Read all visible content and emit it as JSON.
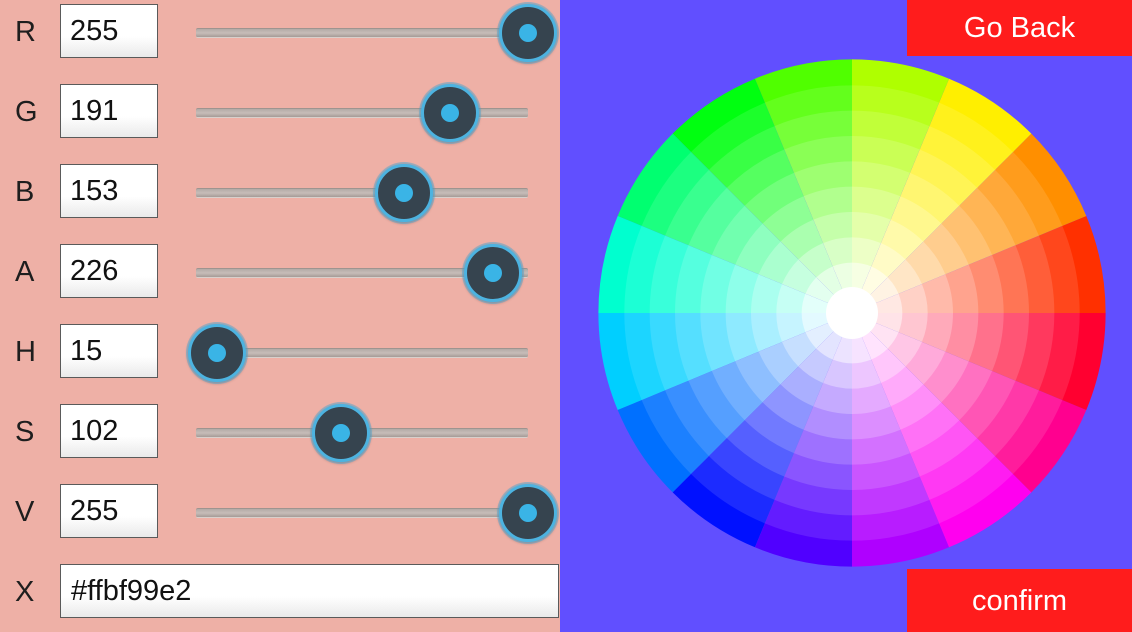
{
  "channels": [
    {
      "label": "R",
      "value": "255",
      "fraction": 1.0
    },
    {
      "label": "G",
      "value": "191",
      "fraction": 0.749
    },
    {
      "label": "B",
      "value": "153",
      "fraction": 0.6
    },
    {
      "label": "A",
      "value": "226",
      "fraction": 0.886
    },
    {
      "label": "H",
      "value": "15",
      "fraction": 0.0
    },
    {
      "label": "S",
      "value": "102",
      "fraction": 0.4
    },
    {
      "label": "V",
      "value": "255",
      "fraction": 1.0
    }
  ],
  "hex": {
    "label": "X",
    "value": "#ffbf99e2"
  },
  "buttons": {
    "go_back": "Go Back",
    "confirm": "confirm"
  },
  "colors": {
    "left_panel": "#eeb0a6",
    "right_panel": "#614fff",
    "button": "#ff1c1c",
    "thumb_ring": "#4db3e0",
    "thumb_body": "#36444f"
  },
  "wheel": {
    "segments": 16,
    "rings": 9
  }
}
